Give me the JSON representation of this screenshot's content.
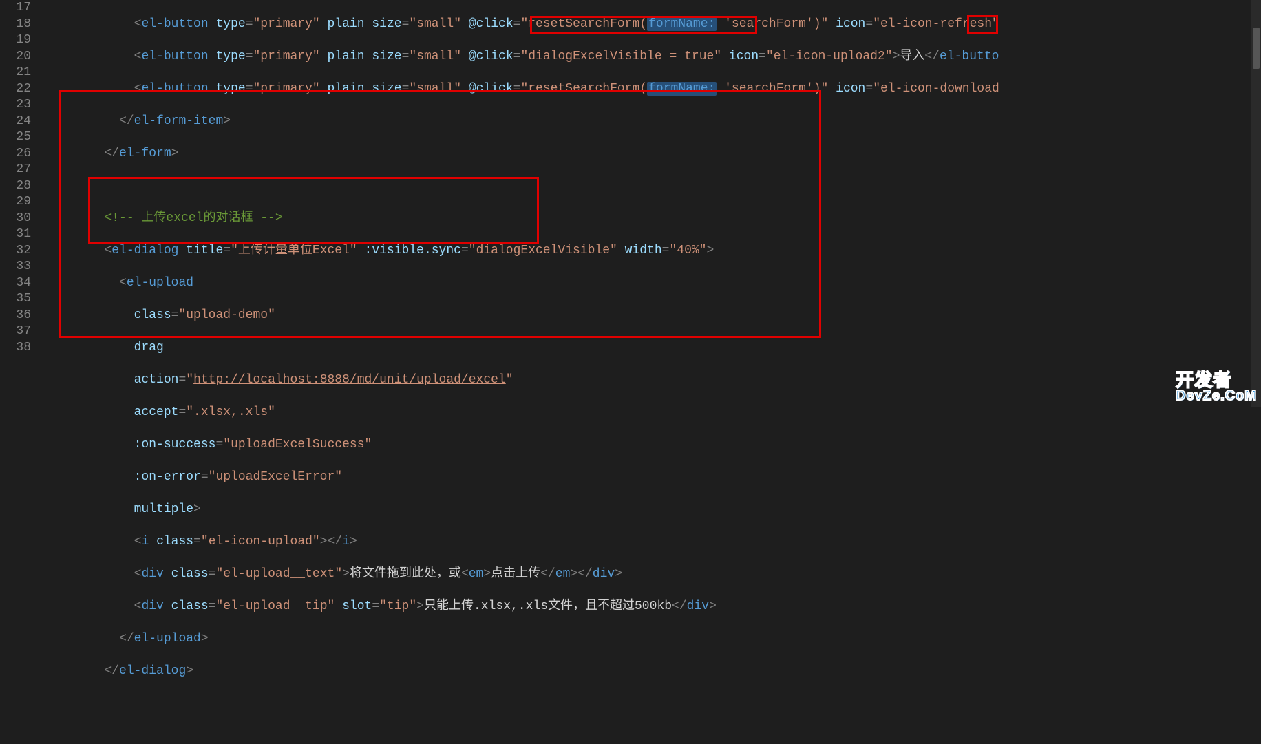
{
  "lineNumbers": [
    "17",
    "18",
    "19",
    "20",
    "21",
    "22",
    "23",
    "24",
    "25",
    "26",
    "27",
    "28",
    "29",
    "30",
    "31",
    "32",
    "33",
    "34",
    "35",
    "36",
    "37",
    "38"
  ],
  "code": {
    "l17": {
      "indent": "            ",
      "btn": "el-button",
      "type_attr": "type",
      "type_val": "\"primary\"",
      "plain": "plain",
      "size_attr": "size",
      "size_val": "\"small\"",
      "click_attr": "@click",
      "click_val": "\"resetSearchForm(",
      "formNameSel": "formName:",
      "sf": " 'searchForm')\"",
      "icon_attr": "icon",
      "icon_val": "\"el-icon-refresh\""
    },
    "l18": {
      "indent": "            ",
      "btn": "el-button",
      "type_attr": "type",
      "type_val": "\"primary\"",
      "plain": "plain",
      "size_attr": "size",
      "size_val": "\"small\"",
      "click_attr": "@click",
      "click_val": "\"dialogExcelVisible = true\"",
      "icon_attr": "icon",
      "icon_val": "\"el-icon-upload2\"",
      "txt": "导入",
      "close1": "/",
      "close2": "el-butto"
    },
    "l19": {
      "indent": "            ",
      "btn": "el-button",
      "type_attr": "type",
      "type_val": "\"primary\"",
      "plain": "plain",
      "size_attr": "size",
      "size_val": "\"small\"",
      "click_attr": "@click",
      "click_val": "\"resetSearchForm(",
      "formNameSel": "formName:",
      "sf": " 'searchForm')\"",
      "icon_attr": "icon",
      "icon_val": "\"el-icon-download"
    },
    "l20": {
      "indent": "          ",
      "close": "el-form-item"
    },
    "l21": {
      "indent": "        ",
      "close": "el-form"
    },
    "l23": {
      "indent": "        ",
      "comment": "<!-- 上传excel的对话框 -->"
    },
    "l24": {
      "indent": "        ",
      "tag": "el-dialog",
      "title_attr": "title",
      "title_val": "\"上传计量单位Excel\"",
      "vis_attr": ":visible.sync",
      "vis_val": "\"dialogExcelVisible\"",
      "width_attr": "width",
      "width_val": "\"40%\""
    },
    "l25": {
      "indent": "          ",
      "tag": "el-upload"
    },
    "l26": {
      "indent": "            ",
      "attr": "class",
      "val": "\"upload-demo\""
    },
    "l27": {
      "indent": "            ",
      "attr": "drag"
    },
    "l28": {
      "indent": "            ",
      "attr": "action",
      "val_pre": "\"",
      "url": "http://localhost:8888/md/unit/upload/excel",
      "val_post": "\""
    },
    "l29": {
      "indent": "            ",
      "attr": "accept",
      "val": "\".xlsx,.xls\""
    },
    "l30": {
      "indent": "            ",
      "attr": ":on-success",
      "val": "\"uploadExcelSuccess\""
    },
    "l31": {
      "indent": "            ",
      "attr": ":on-error",
      "val": "\"uploadExcelError\""
    },
    "l32": {
      "indent": "            ",
      "attr": "multiple"
    },
    "l33": {
      "indent": "            ",
      "tag": "i",
      "cls_attr": "class",
      "cls_val": "\"el-icon-upload\""
    },
    "l34": {
      "indent": "            ",
      "tag": "div",
      "cls_attr": "class",
      "cls_val": "\"el-upload__text\"",
      "t1": "将文件拖到此处，或",
      "em": "em",
      "t2": "点击上传"
    },
    "l35": {
      "indent": "            ",
      "tag": "div",
      "cls_attr": "class",
      "cls_val": "\"el-upload__tip\"",
      "slot_attr": "slot",
      "slot_val": "\"tip\"",
      "t1": "只能上传.xlsx,.xls文件，且不超过500kb"
    },
    "l36": {
      "indent": "          ",
      "close": "el-upload"
    },
    "l37": {
      "indent": "        ",
      "close": "el-dialog"
    }
  },
  "logo": {
    "l1": "开发者",
    "l2": "DevZe.CoM"
  }
}
